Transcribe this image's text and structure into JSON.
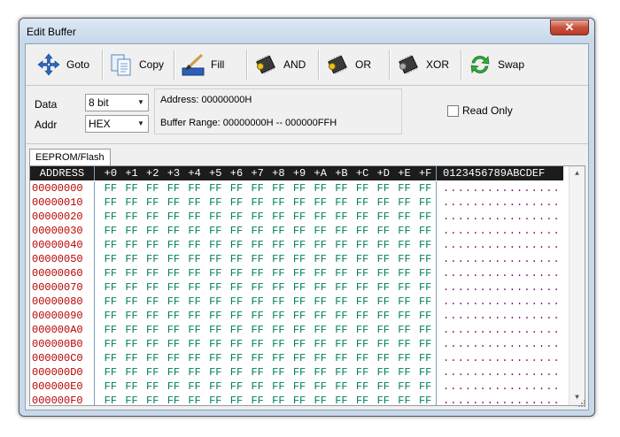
{
  "window": {
    "title": "Edit Buffer",
    "close_glyph": "✕"
  },
  "toolbar": {
    "buttons": [
      {
        "label": "Goto",
        "icon": "move-arrows-icon"
      },
      {
        "label": "Copy",
        "icon": "copy-pages-icon"
      },
      {
        "label": "Fill",
        "icon": "fill-brush-icon"
      },
      {
        "label": "AND",
        "icon": "chip-and-icon"
      },
      {
        "label": "OR",
        "icon": "chip-or-icon"
      },
      {
        "label": "XOR",
        "icon": "chip-xor-icon"
      },
      {
        "label": "Swap",
        "icon": "swap-arrows-icon"
      }
    ]
  },
  "settings": {
    "data_label": "Data",
    "data_value": "8 bit",
    "addr_label": "Addr",
    "addr_value": "HEX",
    "address_text": "Address: 00000000H",
    "range_text": "Buffer Range: 00000000H -- 000000FFH",
    "readonly_label": "Read Only",
    "readonly_checked": false
  },
  "tabs": [
    {
      "label": "EEPROM/Flash",
      "active": true
    }
  ],
  "grid": {
    "header_address": "ADDRESS",
    "header_columns": [
      "+0",
      "+1",
      "+2",
      "+3",
      "+4",
      "+5",
      "+6",
      "+7",
      "+8",
      "+9",
      "+A",
      "+B",
      "+C",
      "+D",
      "+E",
      "+F"
    ],
    "header_ascii": "0123456789ABCDEF",
    "rows": [
      {
        "address": "00000000",
        "bytes": [
          "FF",
          "FF",
          "FF",
          "FF",
          "FF",
          "FF",
          "FF",
          "FF",
          "FF",
          "FF",
          "FF",
          "FF",
          "FF",
          "FF",
          "FF",
          "FF"
        ],
        "ascii": "................"
      },
      {
        "address": "00000010",
        "bytes": [
          "FF",
          "FF",
          "FF",
          "FF",
          "FF",
          "FF",
          "FF",
          "FF",
          "FF",
          "FF",
          "FF",
          "FF",
          "FF",
          "FF",
          "FF",
          "FF"
        ],
        "ascii": "................"
      },
      {
        "address": "00000020",
        "bytes": [
          "FF",
          "FF",
          "FF",
          "FF",
          "FF",
          "FF",
          "FF",
          "FF",
          "FF",
          "FF",
          "FF",
          "FF",
          "FF",
          "FF",
          "FF",
          "FF"
        ],
        "ascii": "................"
      },
      {
        "address": "00000030",
        "bytes": [
          "FF",
          "FF",
          "FF",
          "FF",
          "FF",
          "FF",
          "FF",
          "FF",
          "FF",
          "FF",
          "FF",
          "FF",
          "FF",
          "FF",
          "FF",
          "FF"
        ],
        "ascii": "................"
      },
      {
        "address": "00000040",
        "bytes": [
          "FF",
          "FF",
          "FF",
          "FF",
          "FF",
          "FF",
          "FF",
          "FF",
          "FF",
          "FF",
          "FF",
          "FF",
          "FF",
          "FF",
          "FF",
          "FF"
        ],
        "ascii": "................"
      },
      {
        "address": "00000050",
        "bytes": [
          "FF",
          "FF",
          "FF",
          "FF",
          "FF",
          "FF",
          "FF",
          "FF",
          "FF",
          "FF",
          "FF",
          "FF",
          "FF",
          "FF",
          "FF",
          "FF"
        ],
        "ascii": "................"
      },
      {
        "address": "00000060",
        "bytes": [
          "FF",
          "FF",
          "FF",
          "FF",
          "FF",
          "FF",
          "FF",
          "FF",
          "FF",
          "FF",
          "FF",
          "FF",
          "FF",
          "FF",
          "FF",
          "FF"
        ],
        "ascii": "................"
      },
      {
        "address": "00000070",
        "bytes": [
          "FF",
          "FF",
          "FF",
          "FF",
          "FF",
          "FF",
          "FF",
          "FF",
          "FF",
          "FF",
          "FF",
          "FF",
          "FF",
          "FF",
          "FF",
          "FF"
        ],
        "ascii": "................"
      },
      {
        "address": "00000080",
        "bytes": [
          "FF",
          "FF",
          "FF",
          "FF",
          "FF",
          "FF",
          "FF",
          "FF",
          "FF",
          "FF",
          "FF",
          "FF",
          "FF",
          "FF",
          "FF",
          "FF"
        ],
        "ascii": "................"
      },
      {
        "address": "00000090",
        "bytes": [
          "FF",
          "FF",
          "FF",
          "FF",
          "FF",
          "FF",
          "FF",
          "FF",
          "FF",
          "FF",
          "FF",
          "FF",
          "FF",
          "FF",
          "FF",
          "FF"
        ],
        "ascii": "................"
      },
      {
        "address": "000000A0",
        "bytes": [
          "FF",
          "FF",
          "FF",
          "FF",
          "FF",
          "FF",
          "FF",
          "FF",
          "FF",
          "FF",
          "FF",
          "FF",
          "FF",
          "FF",
          "FF",
          "FF"
        ],
        "ascii": "................"
      },
      {
        "address": "000000B0",
        "bytes": [
          "FF",
          "FF",
          "FF",
          "FF",
          "FF",
          "FF",
          "FF",
          "FF",
          "FF",
          "FF",
          "FF",
          "FF",
          "FF",
          "FF",
          "FF",
          "FF"
        ],
        "ascii": "................"
      },
      {
        "address": "000000C0",
        "bytes": [
          "FF",
          "FF",
          "FF",
          "FF",
          "FF",
          "FF",
          "FF",
          "FF",
          "FF",
          "FF",
          "FF",
          "FF",
          "FF",
          "FF",
          "FF",
          "FF"
        ],
        "ascii": "................"
      },
      {
        "address": "000000D0",
        "bytes": [
          "FF",
          "FF",
          "FF",
          "FF",
          "FF",
          "FF",
          "FF",
          "FF",
          "FF",
          "FF",
          "FF",
          "FF",
          "FF",
          "FF",
          "FF",
          "FF"
        ],
        "ascii": "................"
      },
      {
        "address": "000000E0",
        "bytes": [
          "FF",
          "FF",
          "FF",
          "FF",
          "FF",
          "FF",
          "FF",
          "FF",
          "FF",
          "FF",
          "FF",
          "FF",
          "FF",
          "FF",
          "FF",
          "FF"
        ],
        "ascii": "................"
      },
      {
        "address": "000000F0",
        "bytes": [
          "FF",
          "FF",
          "FF",
          "FF",
          "FF",
          "FF",
          "FF",
          "FF",
          "FF",
          "FF",
          "FF",
          "FF",
          "FF",
          "FF",
          "FF",
          "FF"
        ],
        "ascii": "................"
      }
    ]
  },
  "colors": {
    "address": "#b80000",
    "bytes": "#008060",
    "ascii": "#7a0070",
    "header_bg": "#1c1c1c"
  }
}
